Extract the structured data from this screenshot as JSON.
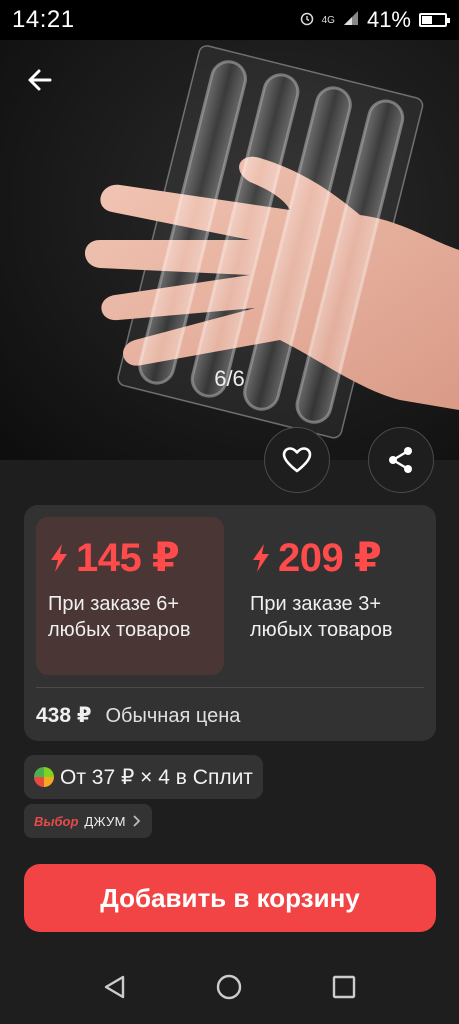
{
  "status_bar": {
    "time": "14:21",
    "network": "4G",
    "battery_percent": "41%",
    "battery_level": 0.41
  },
  "gallery": {
    "counter": "6/6"
  },
  "pricing": {
    "tiers": [
      {
        "price": "145 ₽",
        "condition": "При заказе 6+ любых товаров",
        "active": true
      },
      {
        "price": "209 ₽",
        "condition": "При заказе 3+ любых товаров",
        "active": false
      }
    ],
    "regular_price": "438 ₽",
    "regular_label": "Обычная цена"
  },
  "split": {
    "text": "От 37 ₽ × 4 в Сплит"
  },
  "choice": {
    "brand": "Выбор",
    "name": "ДЖУМ"
  },
  "actions": {
    "add_to_cart": "Добавить в корзину"
  },
  "colors": {
    "accent": "#f24444",
    "price_red": "#ff4b4b",
    "card_bg": "#323232",
    "active_tier_bg": "#4a3634",
    "page_bg": "#1e1e1e"
  },
  "icons": [
    "back-arrow-icon",
    "heart-icon",
    "share-icon",
    "lightning-icon",
    "chevron-right-icon",
    "split-logo-icon",
    "nav-back-icon",
    "nav-home-icon",
    "nav-recents-icon"
  ]
}
